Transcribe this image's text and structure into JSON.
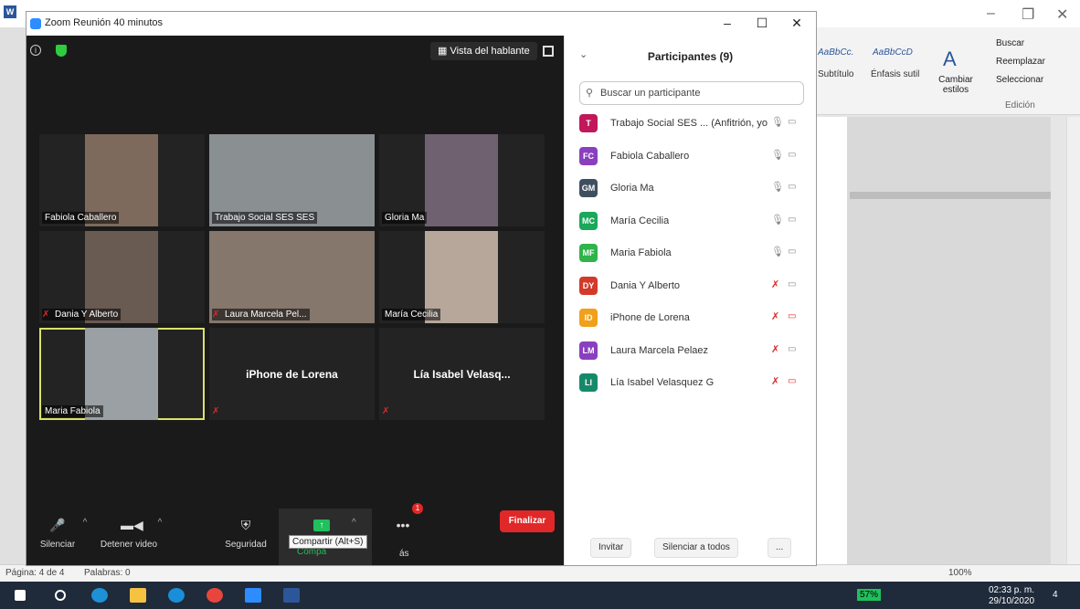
{
  "zoom": {
    "title": "Zoom Reunión 40 minutos",
    "speaker_view": "Vista del hablante",
    "tiles": [
      {
        "name": "Fabiola Caballero",
        "muted": false,
        "bg": "#7d6a5c"
      },
      {
        "name": "Trabajo Social SES SES",
        "muted": false,
        "bg": "#8a8f92"
      },
      {
        "name": "Gloria Ma",
        "muted": false,
        "bg": "#6f6170"
      },
      {
        "name": "Dania Y Alberto",
        "muted": true,
        "bg": "#695a52"
      },
      {
        "name": "Laura Marcela Pel...",
        "muted": true,
        "bg": "#85776c"
      },
      {
        "name": "María Cecilia",
        "muted": false,
        "bg": "#b6a79a"
      },
      {
        "name": "Maria Fabiola",
        "muted": false,
        "bg": "#9aa0a3"
      },
      {
        "name": "iPhone de Lorena",
        "muted": true,
        "bg": "#232323"
      },
      {
        "name": "Lía Isabel Velasq...",
        "muted": true,
        "bg": "#232323"
      }
    ],
    "toolbar": {
      "mute": "Silenciar",
      "video": "Detener video",
      "security": "Seguridad",
      "share": "Compa",
      "share_tooltip": "Compartir (Alt+S)",
      "more_suffix": "ás",
      "more_badge": "1",
      "end": "Finalizar"
    },
    "participants": {
      "title": "Participantes (9)",
      "search_placeholder": "Buscar un participante",
      "list": [
        {
          "initials": "T",
          "name": "Trabajo Social SES ... (Anfitrión, yo)",
          "color": "#c0185a",
          "mic_muted": false,
          "cam_off": false
        },
        {
          "initials": "FC",
          "name": "Fabiola Caballero",
          "color": "#8a3fbf",
          "mic_muted": false,
          "cam_off": false
        },
        {
          "initials": "GM",
          "name": "Gloria Ma",
          "color": "#3f4f5f",
          "mic_muted": false,
          "cam_off": false
        },
        {
          "initials": "MC",
          "name": "María Cecilia",
          "color": "#1aa85a",
          "mic_muted": false,
          "cam_off": false
        },
        {
          "initials": "MF",
          "name": "Maria Fabiola",
          "color": "#2fb34a",
          "mic_muted": false,
          "cam_off": false
        },
        {
          "initials": "DY",
          "name": "Dania Y Alberto",
          "color": "#d23a2a",
          "mic_muted": true,
          "cam_off": false
        },
        {
          "initials": "ID",
          "name": "iPhone de Lorena",
          "color": "#f0a01a",
          "mic_muted": true,
          "cam_off": true
        },
        {
          "initials": "LM",
          "name": "Laura Marcela Pelaez",
          "color": "#8a3fbf",
          "mic_muted": true,
          "cam_off": false
        },
        {
          "initials": "LI",
          "name": "Lía Isabel Velasquez G",
          "color": "#16896a",
          "mic_muted": true,
          "cam_off": true
        }
      ],
      "invite": "Invitar",
      "mute_all": "Silenciar a todos",
      "more": "..."
    }
  },
  "word": {
    "styles": [
      "AaBbCc.",
      "AaBbCcD",
      "Subtítulo",
      "Énfasis sutil"
    ],
    "change_styles": "Cambiar estilos",
    "find": "Buscar",
    "replace": "Reemplazar",
    "select": "Seleccionar",
    "editing": "Edición",
    "status_page": "Página: 4 de 4",
    "status_words": "Palabras: 0",
    "zoom_level": "100%"
  },
  "taskbar": {
    "battery": "57%",
    "time": "02:33 p. m.",
    "date": "29/10/2020",
    "notif": "4"
  }
}
